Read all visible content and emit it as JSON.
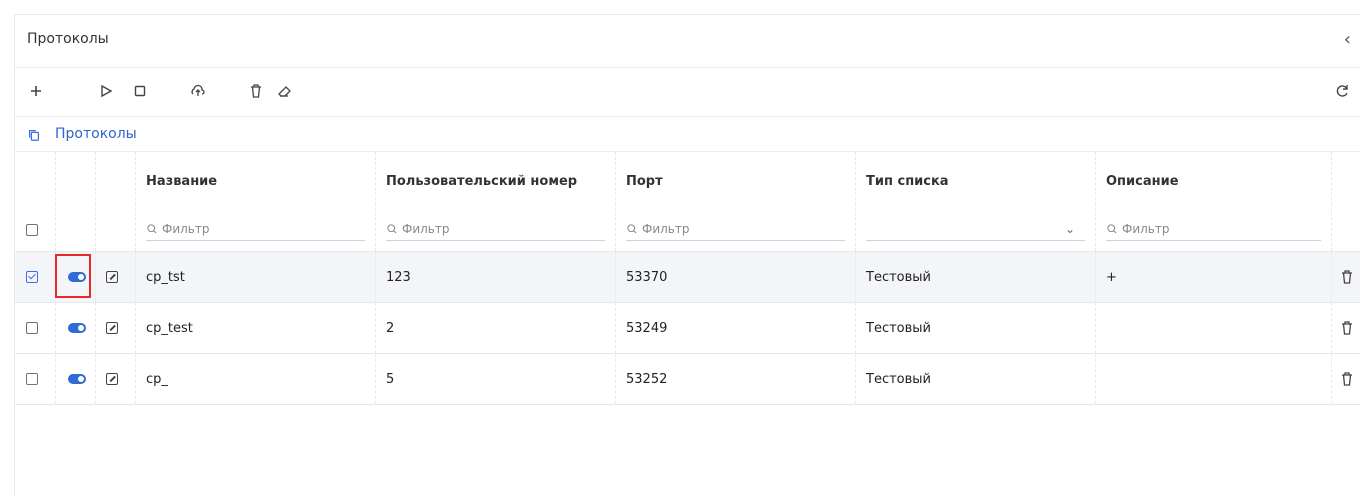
{
  "panel": {
    "title": "Протоколы"
  },
  "toolbar": {
    "items": [
      "add-icon",
      "play-icon",
      "stop-icon",
      "upload-icon",
      "trash-icon",
      "eraser-icon"
    ],
    "refresh": "refresh-icon"
  },
  "breadcrumb": {
    "label": "Протоколы"
  },
  "table": {
    "columns": {
      "name": "Название",
      "user_number": "Пользовательский номер",
      "port": "Порт",
      "list_type": "Тип списка",
      "description": "Описание"
    },
    "filters": {
      "name": "Фильтр",
      "user_number": "Фильтр",
      "port": "Фильтр",
      "description": "Фильтр"
    },
    "rows": [
      {
        "checked": true,
        "name": "cp_tst",
        "user_number": "123",
        "port": "53370",
        "list_type": "Тестовый",
        "description": "+"
      },
      {
        "checked": false,
        "name": "cp_test",
        "user_number": "2",
        "port": "53249",
        "list_type": "Тестовый",
        "description": ""
      },
      {
        "checked": false,
        "name": "cp_",
        "user_number": "5",
        "port": "53252",
        "list_type": "Тестовый",
        "description": ""
      }
    ]
  },
  "colors": {
    "accent": "#2f6bd6",
    "highlight": "#e32b2b"
  }
}
